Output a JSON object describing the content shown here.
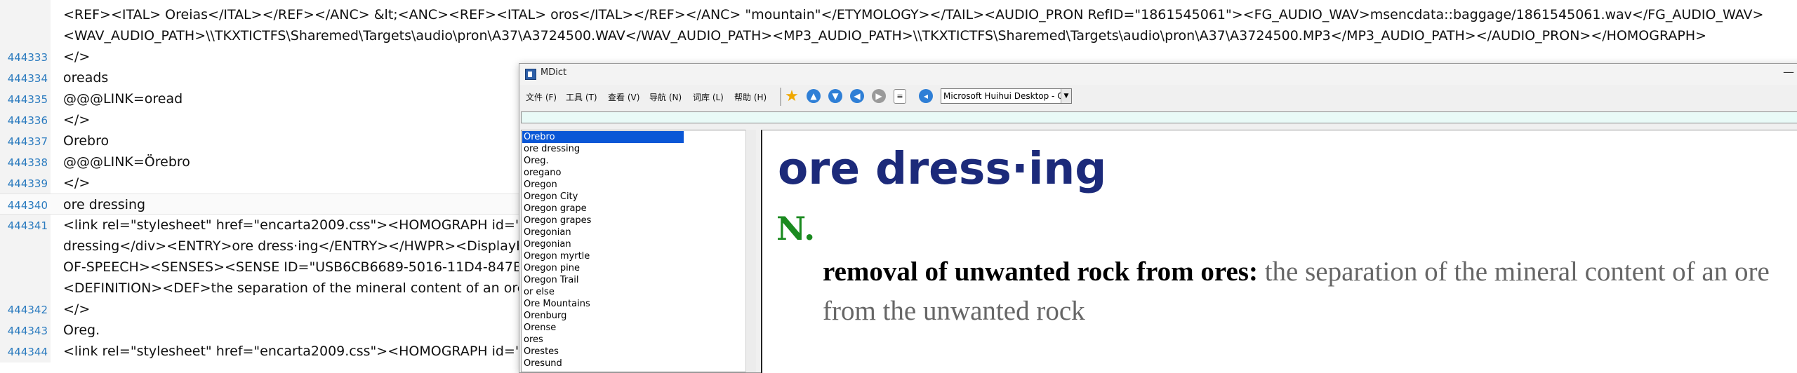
{
  "editor": {
    "lines": [
      {
        "num": "",
        "text": "<REF><ITAL> Oreias</ITAL></REF></ANC> &lt;<ANC><REF><ITAL> oros</ITAL></REF></ANC> \"mountain\"</ETYMOLOGY></TAIL><AUDIO_PRON RefID=\"1861545061\"><FG_AUDIO_WAV>msencdata::baggage/1861545061.wav</FG_AUDIO_WAV>"
      },
      {
        "num": "",
        "text": "<WAV_AUDIO_PATH>\\\\TKXTICTFS\\Sharemed\\Targets\\audio\\pron\\A37\\A3724500.WAV</WAV_AUDIO_PATH><MP3_AUDIO_PATH>\\\\TKXTICTFS\\Sharemed\\Targets\\audio\\pron\\A37\\A3724500.MP3</MP3_AUDIO_PATH></AUDIO_PRON></HOMOGRAPH>"
      },
      {
        "num": "444333",
        "text": "</>"
      },
      {
        "num": "444334",
        "text": "oreads"
      },
      {
        "num": "444335",
        "text": "@@@LINK=oread"
      },
      {
        "num": "444336",
        "text": "</>"
      },
      {
        "num": "444337",
        "text": "Orebro"
      },
      {
        "num": "444338",
        "text": "@@@LINK=Örebro"
      },
      {
        "num": "444339",
        "text": "</>"
      },
      {
        "num": "444340",
        "text": "ore dressing"
      },
      {
        "num": "444341",
        "text": "<link rel=\"stylesheet\" href=\"encarta2009.css\"><HOMOGRAPH id=\"U"
      },
      {
        "num": "",
        "text": "dressing</div><ENTRY>ore dress·ing</ENTRY></HWPR><DisplayH"
      },
      {
        "num": "",
        "text": "OF-SPEECH><SENSES><SENSE ID=\"USB6CB6689-5016-11D4-847B-0"
      },
      {
        "num": "",
        "text": "<DEFINITION><DEF>the separation of the mineral content of an ore"
      },
      {
        "num": "444342",
        "text": "</>"
      },
      {
        "num": "444343",
        "text": "Oreg."
      },
      {
        "num": "444344",
        "text": "<link rel=\"stylesheet\" href=\"encarta2009.css\"><HOMOGRAPH id=\"U"
      }
    ]
  },
  "mdict": {
    "title": "MDict",
    "minimize_glyph": "—",
    "menus": [
      "文件 (F)",
      "工具 (T)",
      "查看 (V)",
      "导航 (N)",
      "词库 (L)",
      "帮助 (H)"
    ],
    "toolbar": {
      "favorite_icon": "star-icon",
      "font_select_value": "Microsoft Huihui Desktop - C"
    },
    "search_value": "",
    "wordlist": [
      "Orebro",
      "ore dressing",
      "Oreg.",
      "oregano",
      "Oregon",
      "Oregon City",
      "Oregon grape",
      "Oregon grapes",
      "Oregonian",
      "Oregonian",
      "Oregon myrtle",
      "Oregon pine",
      "Oregon Trail",
      "or else",
      "Ore Mountains",
      "Orenburg",
      "Orense",
      "ores",
      "Orestes",
      "Oresund"
    ],
    "selected_index": 0,
    "entry": {
      "headword": "ore dress·ing",
      "pos": "N.",
      "sense_label": "removal of unwanted rock from ores:",
      "definition": " the separation of the mineral content of an ore from the unwanted rock"
    },
    "colors": {
      "headword": "#1c2a7a",
      "pos": "#1a8a1f",
      "selection": "#0a57d6",
      "search_bg": "#e9faf7"
    }
  }
}
